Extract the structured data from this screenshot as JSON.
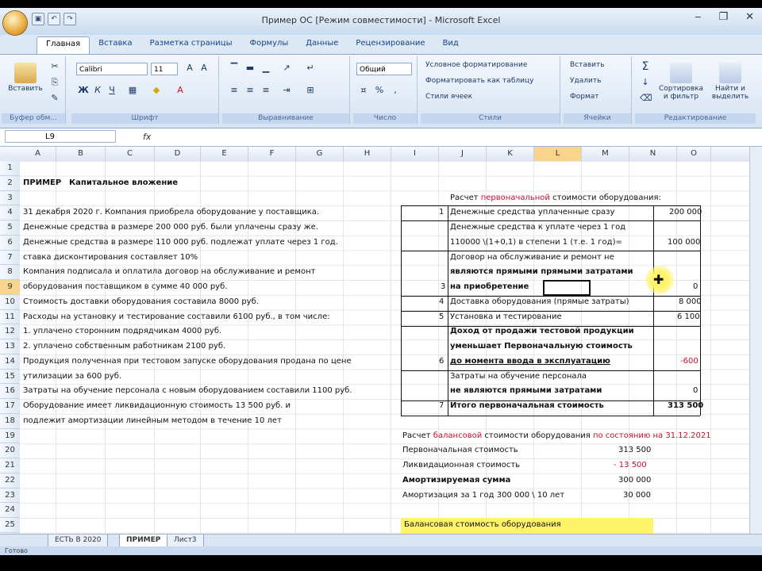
{
  "window": {
    "title": "Пример ОС [Режим совместимости] - Microsoft Excel",
    "controls": [
      "‒",
      "❐",
      "✕"
    ]
  },
  "tabs": [
    "Главная",
    "Вставка",
    "Разметка страницы",
    "Формулы",
    "Данные",
    "Рецензирование",
    "Вид"
  ],
  "ribbon": {
    "paste_label": "Вставить",
    "clipboard_label": "Буфер обм...",
    "font_name": "Calibri",
    "font_size": "11",
    "font_group_label": "Шрифт",
    "align_group_label": "Выравнивание",
    "number_format": "Общий",
    "number_group_label": "Число",
    "styles_items": [
      "Условное форматирование",
      "Форматировать как таблицу",
      "Стили ячеек"
    ],
    "styles_group_label": "Стили",
    "cells_items": [
      "Вставить",
      "Удалить",
      "Формат"
    ],
    "cells_group_label": "Ячейки",
    "sort_label": "Сортировка и фильтр",
    "find_label": "Найти и выделить",
    "edit_group_label": "Редактирование"
  },
  "formula_bar": {
    "name_box": "L9",
    "fx": "fx",
    "value": ""
  },
  "columns": [
    "A",
    "B",
    "C",
    "D",
    "E",
    "F",
    "G",
    "H",
    "I",
    "J",
    "K",
    "L",
    "M",
    "N",
    "O"
  ],
  "rows": [
    "1",
    "2",
    "3",
    "4",
    "5",
    "6",
    "7",
    "8",
    "9",
    "10",
    "11",
    "12",
    "13",
    "14",
    "15",
    "16",
    "17",
    "18",
    "19",
    "20",
    "21",
    "22",
    "23",
    "24",
    "25"
  ],
  "left_text": {
    "r2_a": "ПРИМЕР",
    "r2_b": "Капитальное вложение",
    "r4": "31 декабря 2020 г. Компания приобрела оборудование у поставщика.",
    "r5": "Денежные средства в размере 200 000 руб. были уплачены сразу же.",
    "r6": "Денежные средства в размере 110 000 руб. подлежат уплате через 1 год.",
    "r7": "ставка дисконтирования составляет 10%",
    "r8": "Компания подписала и оплатила договор на обслуживание и ремонт",
    "r9": "оборудования поставщиком в сумме 40 000 руб.",
    "r10": "Стоимость доставки оборудования составила 8000 руб.",
    "r11": "Расходы на установку и тестирование составили  6100 руб., в том числе:",
    "r12": "1. уплачено сторонним подрядчикам 4000 руб.",
    "r13": "2. уплачено собственным работникам 2100 руб.",
    "r14": "Продукция полученная при тестовом запуске оборудования продана по цене",
    "r15": "утилизации за 600 руб.",
    "r16": "Затраты на обучение персонала с новым оборудованием составили 1100 руб.",
    "r17": "Оборудование имеет ликвидационную стоимость 13 500 руб. и",
    "r18": "подлежит амортизации линейным методом в течение 10 лет"
  },
  "calc1": {
    "title_a": "Расчет ",
    "title_red": "первоначальной",
    "title_b": " стоимости оборудования:",
    "n1": "1",
    "t1": "Денежные средства уплаченные сразу",
    "v1": "200 000",
    "t2": "Денежные средства к уплате через 1 год",
    "t3": "110000 \\(1+0,1) в степени 1 (т.е. 1 год)=",
    "v3": "100 000",
    "t4a": "Договор на обслуживание и ремонт не",
    "t4b": "являются прямыми прямыми затратами",
    "t4c": "на приобретение",
    "n4": "3",
    "v4": "0",
    "n5": "4",
    "t5": "Доставка оборудования (прямые затраты)",
    "v5": "8 000",
    "n6": "5",
    "t6": "Установка и тестирование",
    "v6": "6 100",
    "t7a": "Доход от продажи тестовой продукции",
    "t7b": "уменьшает Первоначальную стоимость",
    "t7c": "до момента ввода в эксплуатацию",
    "n7": "6",
    "v7": "-600",
    "t8a": "Затраты на обучение персонала",
    "t8b": "не являются прямыми затратами",
    "v8": "0",
    "n9": "7",
    "t9": "Итого первоначальная стоимость",
    "v9": "313 500"
  },
  "calc2": {
    "title_a": "Расчет ",
    "title_red": "балансовой",
    "title_b": " стоимости оборудования ",
    "title_date": "по состоянию на 31.12.2021",
    "l1": "Первоначальная стоимость",
    "v1": "313 500",
    "l2": "Ликвидационная стоимость",
    "v2": "- 13 500",
    "l3": "Амортизируемая сумма",
    "v3": "300 000",
    "l4": "Амортизация за 1 год 300 000 \\ 10 лет",
    "v4": "30 000",
    "l5": "Балансовая стоимость оборудования"
  },
  "sheets": [
    "ЕСТЬ В 2020",
    "ПРИМЕР",
    "Лист3"
  ],
  "status": "Готово"
}
